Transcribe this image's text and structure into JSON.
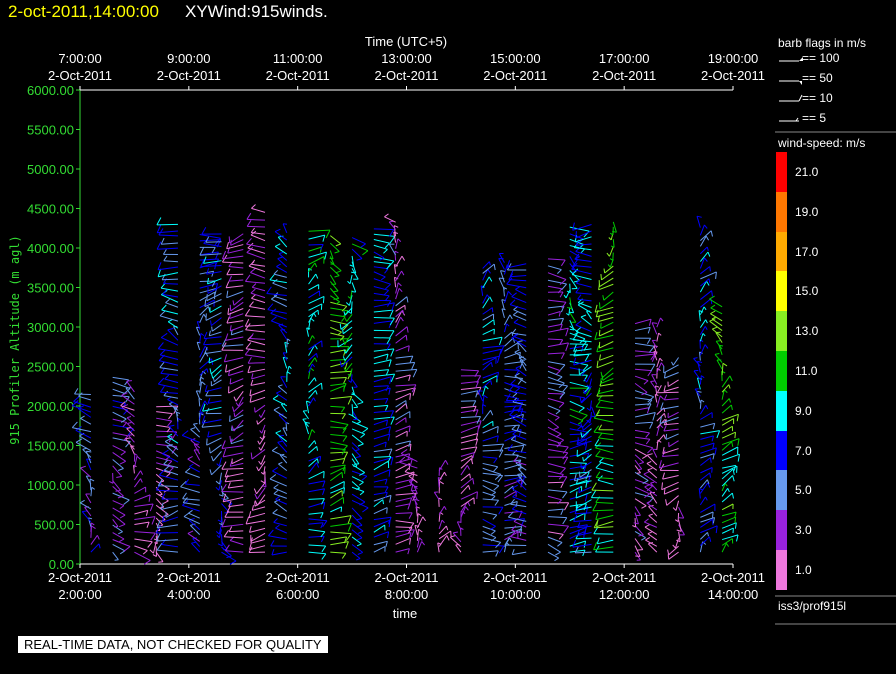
{
  "header": {
    "datetime": "2-oct-2011,14:00:00",
    "product": "XYWind:915winds."
  },
  "chart_data": {
    "type": "scatter",
    "subtype": "wind-barb time-height",
    "xlabel": "time",
    "x2label": "Time (UTC+5)",
    "ylabel": "915 Profiler Altitude (m agl)",
    "ylim": [
      0,
      6000
    ],
    "yticks": [
      "0.00",
      "500.00",
      "1000.00",
      "1500.00",
      "2000.00",
      "2500.00",
      "3000.00",
      "3500.00",
      "4000.00",
      "4500.00",
      "5000.00",
      "5500.00",
      "6000.00"
    ],
    "xticks_bottom": [
      {
        "date": "2-Oct-2011",
        "time": "2:00:00"
      },
      {
        "date": "2-Oct-2011",
        "time": "4:00:00"
      },
      {
        "date": "2-Oct-2011",
        "time": "6:00:00"
      },
      {
        "date": "2-Oct-2011",
        "time": "8:00:00"
      },
      {
        "date": "2-Oct-2011",
        "time": "10:00:00"
      },
      {
        "date": "2-Oct-2011",
        "time": "12:00:00"
      },
      {
        "date": "2-Oct-2011",
        "time": "14:00:00"
      }
    ],
    "xticks_top": [
      {
        "time": "7:00:00",
        "date": "2-Oct-2011"
      },
      {
        "time": "9:00:00",
        "date": "2-Oct-2011"
      },
      {
        "time": "11:00:00",
        "date": "2-Oct-2011"
      },
      {
        "time": "13:00:00",
        "date": "2-Oct-2011"
      },
      {
        "time": "15:00:00",
        "date": "2-Oct-2011"
      },
      {
        "time": "17:00:00",
        "date": "2-Oct-2011"
      },
      {
        "time": "19:00:00",
        "date": "2-Oct-2011"
      }
    ],
    "time_hours_utc": [
      2,
      14
    ],
    "profiles": [
      {
        "t": 2.2,
        "top": 2200,
        "speed": 6
      },
      {
        "t": 2.6,
        "top": 2400,
        "speed": 5
      },
      {
        "t": 3.0,
        "top": 2200,
        "speed": 3
      },
      {
        "t": 3.4,
        "top": 2000,
        "speed": 2
      },
      {
        "t": 3.8,
        "top": 4300,
        "speed": 7
      },
      {
        "t": 4.2,
        "top": 4250,
        "speed": 6
      },
      {
        "t": 4.6,
        "top": 4250,
        "speed": 7
      },
      {
        "t": 5.0,
        "top": 4250,
        "speed": 3
      },
      {
        "t": 5.4,
        "top": 4500,
        "speed": 2
      },
      {
        "t": 5.8,
        "top": 4200,
        "speed": 7
      },
      {
        "t": 6.2,
        "top": 4250,
        "speed": 9
      },
      {
        "t": 6.6,
        "top": 4200,
        "speed": 12
      },
      {
        "t": 7.0,
        "top": 4150,
        "speed": 9
      },
      {
        "t": 7.4,
        "top": 4250,
        "speed": 8
      },
      {
        "t": 7.8,
        "top": 4350,
        "speed": 3
      },
      {
        "t": 8.2,
        "top": 1300,
        "speed": 3
      },
      {
        "t": 8.6,
        "top": 1200,
        "speed": 3
      },
      {
        "t": 9.0,
        "top": 2500,
        "speed": 3
      },
      {
        "t": 9.4,
        "top": 3800,
        "speed": 7
      },
      {
        "t": 9.8,
        "top": 3900,
        "speed": 6
      },
      {
        "t": 10.2,
        "top": 3850,
        "speed": 6
      },
      {
        "t": 10.6,
        "top": 3900,
        "speed": 4
      },
      {
        "t": 11.0,
        "top": 4300,
        "speed": 9
      },
      {
        "t": 11.4,
        "top": 4300,
        "speed": 8
      },
      {
        "t": 11.8,
        "top": 4400,
        "speed": 12
      },
      {
        "t": 12.2,
        "top": 3100,
        "speed": 4
      },
      {
        "t": 12.6,
        "top": 3000,
        "speed": 2
      },
      {
        "t": 13.0,
        "top": 2700,
        "speed": 3
      },
      {
        "t": 13.4,
        "top": 4300,
        "speed": 7
      },
      {
        "t": 13.8,
        "top": 3300,
        "speed": 12
      }
    ],
    "colorbar": {
      "title": "wind-speed: m/s",
      "levels": [
        {
          "label": "21.0",
          "color": "#ff0000"
        },
        {
          "label": "19.0",
          "color": "#ff7700"
        },
        {
          "label": "17.0",
          "color": "#ffaa00"
        },
        {
          "label": "15.0",
          "color": "#ffff00"
        },
        {
          "label": "13.0",
          "color": "#88ee22"
        },
        {
          "label": "11.0",
          "color": "#00cc00"
        },
        {
          "label": "9.0",
          "color": "#00ffff"
        },
        {
          "label": "7.0",
          "color": "#0000ff"
        },
        {
          "label": "5.0",
          "color": "#6699ee"
        },
        {
          "label": "3.0",
          "color": "#9922dd"
        },
        {
          "label": "1.0",
          "color": "#ee77dd"
        }
      ]
    }
  },
  "barb_legend": {
    "title": "barb flags in m/s",
    "items": [
      "== 100",
      "== 50",
      "== 10",
      "== 5"
    ]
  },
  "station": "iss3/prof915l",
  "footer": {
    "quality_note": "REAL-TIME DATA, NOT CHECKED FOR QUALITY"
  }
}
